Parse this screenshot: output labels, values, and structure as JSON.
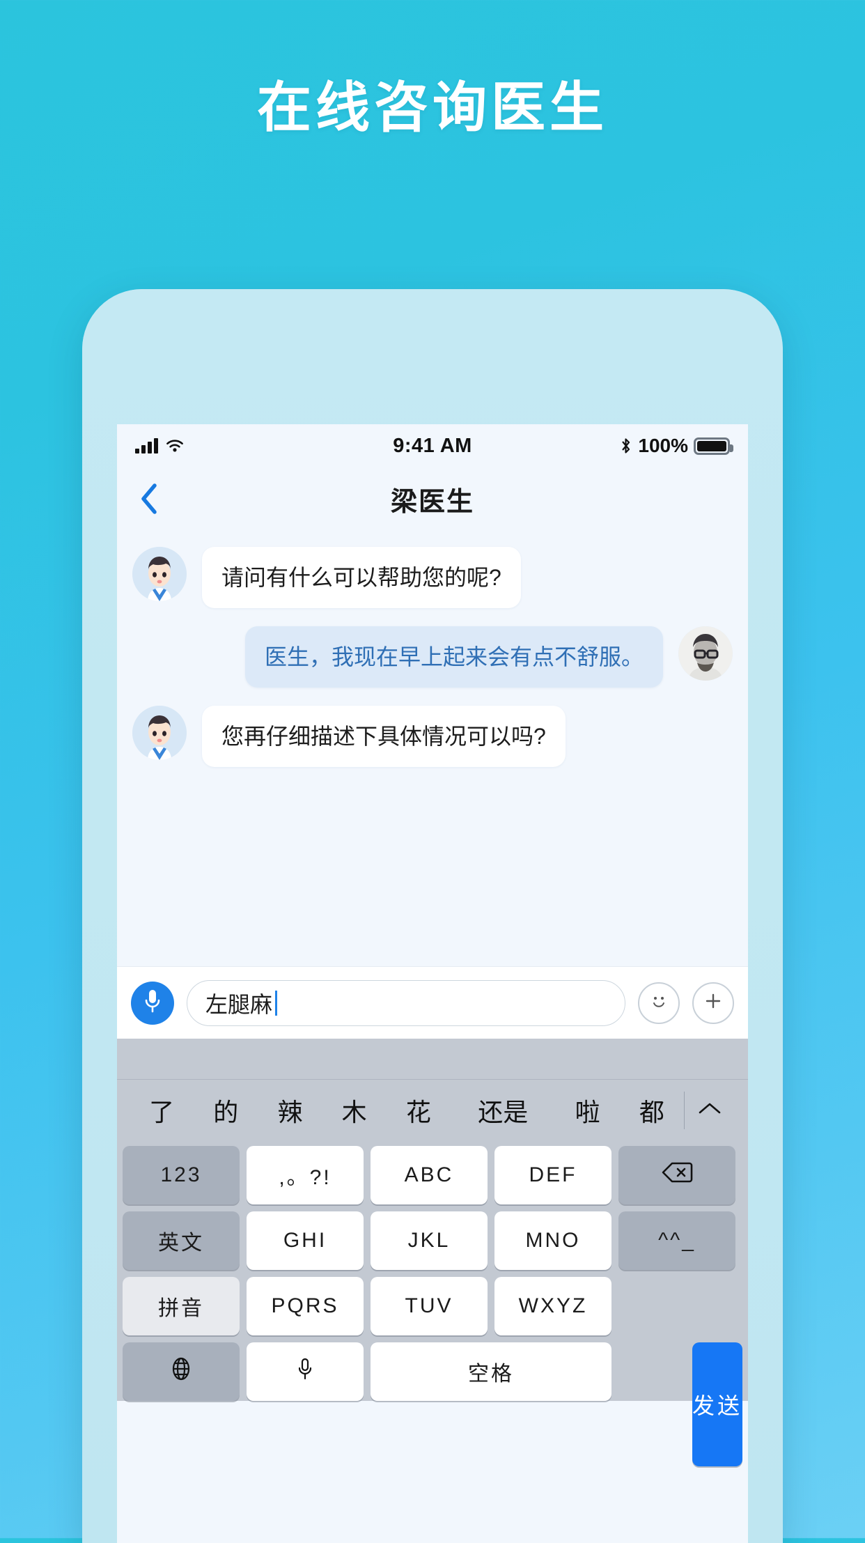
{
  "promo": {
    "title": "在线咨询医生"
  },
  "status_bar": {
    "time": "9:41 AM",
    "battery_percent": "100%",
    "signal_icon": "cellular-signal-icon",
    "wifi_icon": "wifi-icon",
    "bluetooth_icon": "bluetooth-icon",
    "battery_icon": "battery-full-icon"
  },
  "nav": {
    "back_icon": "chevron-left-icon",
    "title": "梁医生"
  },
  "chat": {
    "messages": [
      {
        "side": "left",
        "sender": "doctor",
        "text": "请问有什么可以帮助您的呢?"
      },
      {
        "side": "right",
        "sender": "patient",
        "text": "医生，我现在早上起来会有点不舒服。"
      },
      {
        "side": "left",
        "sender": "doctor",
        "text": "您再仔细描述下具体情况可以吗?"
      }
    ]
  },
  "input_bar": {
    "mic_icon": "microphone-icon",
    "value": "左腿麻",
    "placeholder": "",
    "emoji_icon": "smiley-icon",
    "plus_icon": "plus-icon"
  },
  "keyboard": {
    "candidates": [
      "了",
      "的",
      "辣",
      "木",
      "花",
      "还是",
      "啦",
      "都"
    ],
    "expand_icon": "chevron-up-icon",
    "rows": [
      [
        {
          "label": "123",
          "style": "fn"
        },
        {
          "label": ",。?!",
          "style": "normal"
        },
        {
          "label": "ABC",
          "style": "normal"
        },
        {
          "label": "DEF",
          "style": "normal"
        },
        {
          "label": "",
          "style": "fn",
          "icon": "backspace-icon"
        }
      ],
      [
        {
          "label": "英文",
          "style": "fn"
        },
        {
          "label": "GHI",
          "style": "normal"
        },
        {
          "label": "JKL",
          "style": "normal"
        },
        {
          "label": "MNO",
          "style": "normal"
        },
        {
          "label": "^^_",
          "style": "fn"
        }
      ],
      [
        {
          "label": "拼音",
          "style": "fn-light"
        },
        {
          "label": "PQRS",
          "style": "normal"
        },
        {
          "label": "TUV",
          "style": "normal"
        },
        {
          "label": "WXYZ",
          "style": "normal"
        }
      ],
      [
        {
          "label": "",
          "style": "fn",
          "icon": "globe-icon"
        },
        {
          "label": "",
          "style": "normal",
          "icon": "microphone-icon"
        },
        {
          "label": "空格",
          "style": "normal"
        }
      ]
    ],
    "send_label": "发送"
  },
  "colors": {
    "background_top": "#2bc4dd",
    "background_bottom": "#6bd0f5",
    "accent_blue": "#1f82e8",
    "send_blue": "#1677f5",
    "bubble_user": "#dce9f8",
    "bubble_user_text": "#2f6fb5",
    "screen_bg": "#f2f7fd",
    "keyboard_bg": "#c3c9d2"
  }
}
